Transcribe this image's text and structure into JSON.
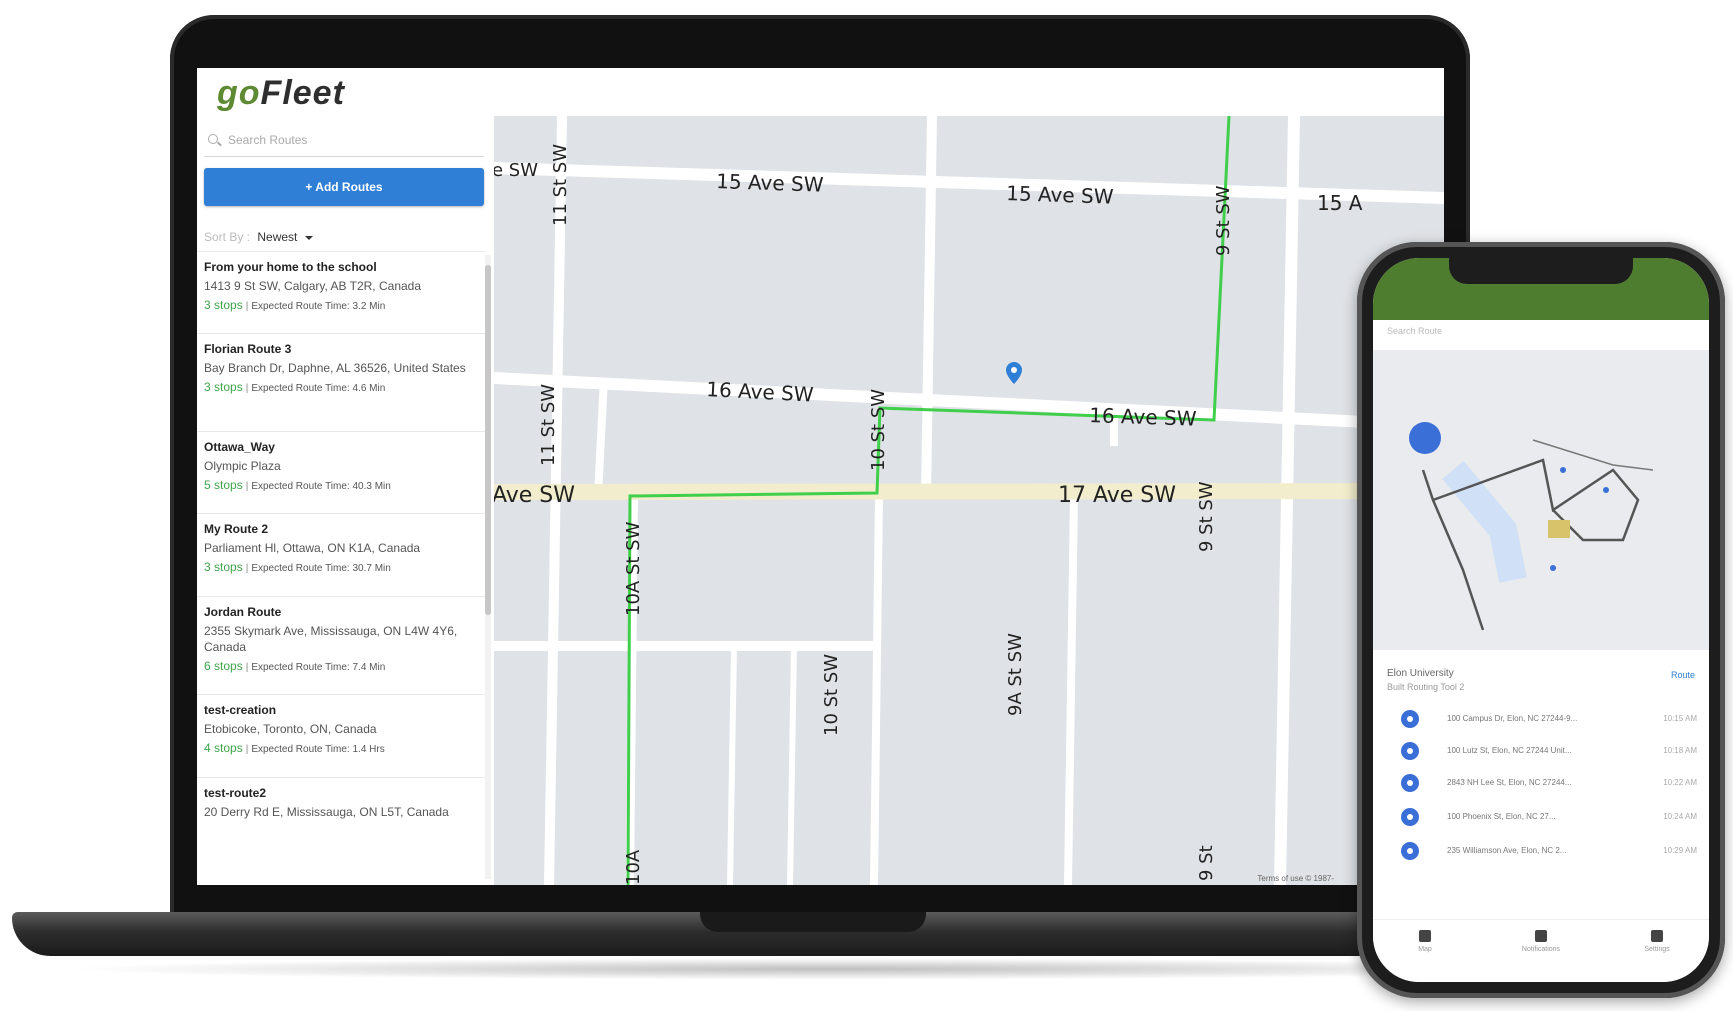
{
  "app": {
    "logo_go": "go",
    "logo_fleet": "Fleet",
    "brand_color": "#5e8a34",
    "accent_color": "#2f7fd6"
  },
  "sidebar": {
    "search_placeholder": "Search Routes",
    "add_button": "+ Add Routes",
    "sort_label": "Sort By :",
    "sort_value": "Newest",
    "routes": [
      {
        "name": "From your home to the school",
        "address": "1413 9 St SW, Calgary, AB T2R, Canada",
        "stops": "3 stops",
        "time": "Expected Route Time: 3.2 Min"
      },
      {
        "name": "Florian Route 3",
        "address": "Bay Branch Dr, Daphne, AL 36526, United States",
        "stops": "3 stops",
        "time": "Expected Route Time: 4.6 Min"
      },
      {
        "name": "Ottawa_Way",
        "address": "Olympic Plaza",
        "stops": "5 stops",
        "time": "Expected Route Time: 40.3 Min"
      },
      {
        "name": "My Route 2",
        "address": "Parliament Hl, Ottawa, ON K1A, Canada",
        "stops": "3 stops",
        "time": "Expected Route Time: 30.7 Min"
      },
      {
        "name": "Jordan Route",
        "address": "2355 Skymark Ave, Mississauga, ON L4W 4Y6, Canada",
        "stops": "6 stops",
        "time": "Expected Route Time: 7.4 Min"
      },
      {
        "name": "test-creation",
        "address": "Etobicoke, Toronto, ON, Canada",
        "stops": "4 stops",
        "time": "Expected Route Time: 1.4 Hrs"
      },
      {
        "name": "test-route2",
        "address": "20 Derry Rd E, Mississauga, ON L5T, Canada",
        "stops": "",
        "time": ""
      }
    ]
  },
  "map": {
    "streets": {
      "ave15": "15 Ave SW",
      "ave15b": "15 Ave SW",
      "ave15c": "15 A",
      "ave15_partial": "e SW",
      "ave16": "16 Ave SW",
      "ave16b": "16 Ave SW",
      "ave17": "17 Ave SW",
      "ave17_partial": "Ave SW",
      "st11a": "11 St SW",
      "st11b": "11 St SW",
      "st10a": "10 St SW",
      "st10b": "10 St SW",
      "st9a": "9 St SW",
      "st9b": "9 St SW",
      "st9c": "9 St",
      "st10Aa": "10A St SW",
      "st10Ab": "10A",
      "st9A": "9A St SW"
    },
    "footer": "Terms of use   © 1987-",
    "route_color": "#3fcf4a",
    "pin_color": "#2f7fd6"
  },
  "phone": {
    "search_placeholder": "Search Route",
    "route_title": "Elon University",
    "route_sub": "Built Routing Tool 2",
    "start_label": "Route",
    "stops": [
      {
        "address": "100 Campus Dr, Elon, NC 27244-9...",
        "eta": "10:15 AM"
      },
      {
        "address": "100 Lutz St, Elon, NC 27244 Unit...",
        "eta": "10:18 AM"
      },
      {
        "address": "2843 NH Lee St, Elon, NC 27244...",
        "eta": "10:22 AM"
      },
      {
        "address": "100 Phoenix St, Elon, NC 27...",
        "eta": "10:24 AM"
      },
      {
        "address": "235 Williamson Ave, Elon, NC 2...",
        "eta": "10:29 AM"
      }
    ],
    "tabs": [
      "Map",
      "Notifications",
      "Settings"
    ]
  }
}
